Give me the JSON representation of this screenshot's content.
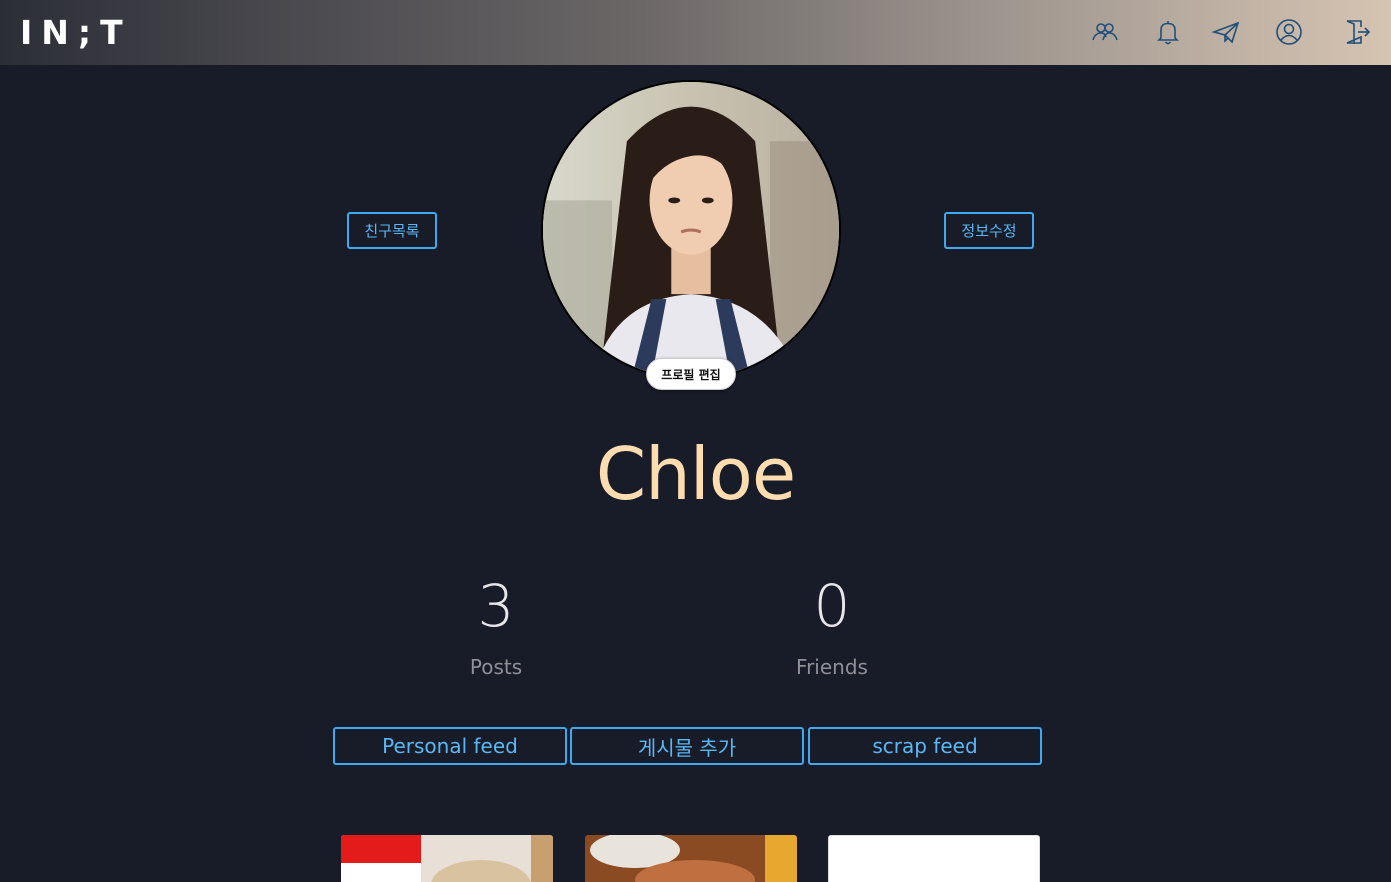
{
  "header": {
    "logo_text": "IN;T",
    "icons": [
      "friends-icon",
      "bell-icon",
      "paper-plane-icon",
      "user-circle-icon",
      "logout-icon"
    ]
  },
  "profile": {
    "friends_list_label": "친구목록",
    "edit_info_label": "정보수정",
    "edit_profile_label": "프로필 편집",
    "username": "Chloe"
  },
  "stats": {
    "posts_count": "3",
    "posts_label": "Posts",
    "friends_count": "0",
    "friends_label": "Friends"
  },
  "feed_tabs": {
    "personal_label": "Personal feed",
    "add_post_label": "게시물 추가",
    "scrap_label": "scrap feed"
  },
  "colors": {
    "background": "#181b28",
    "accent": "#3fa9f0",
    "username": "#fddcb0"
  }
}
